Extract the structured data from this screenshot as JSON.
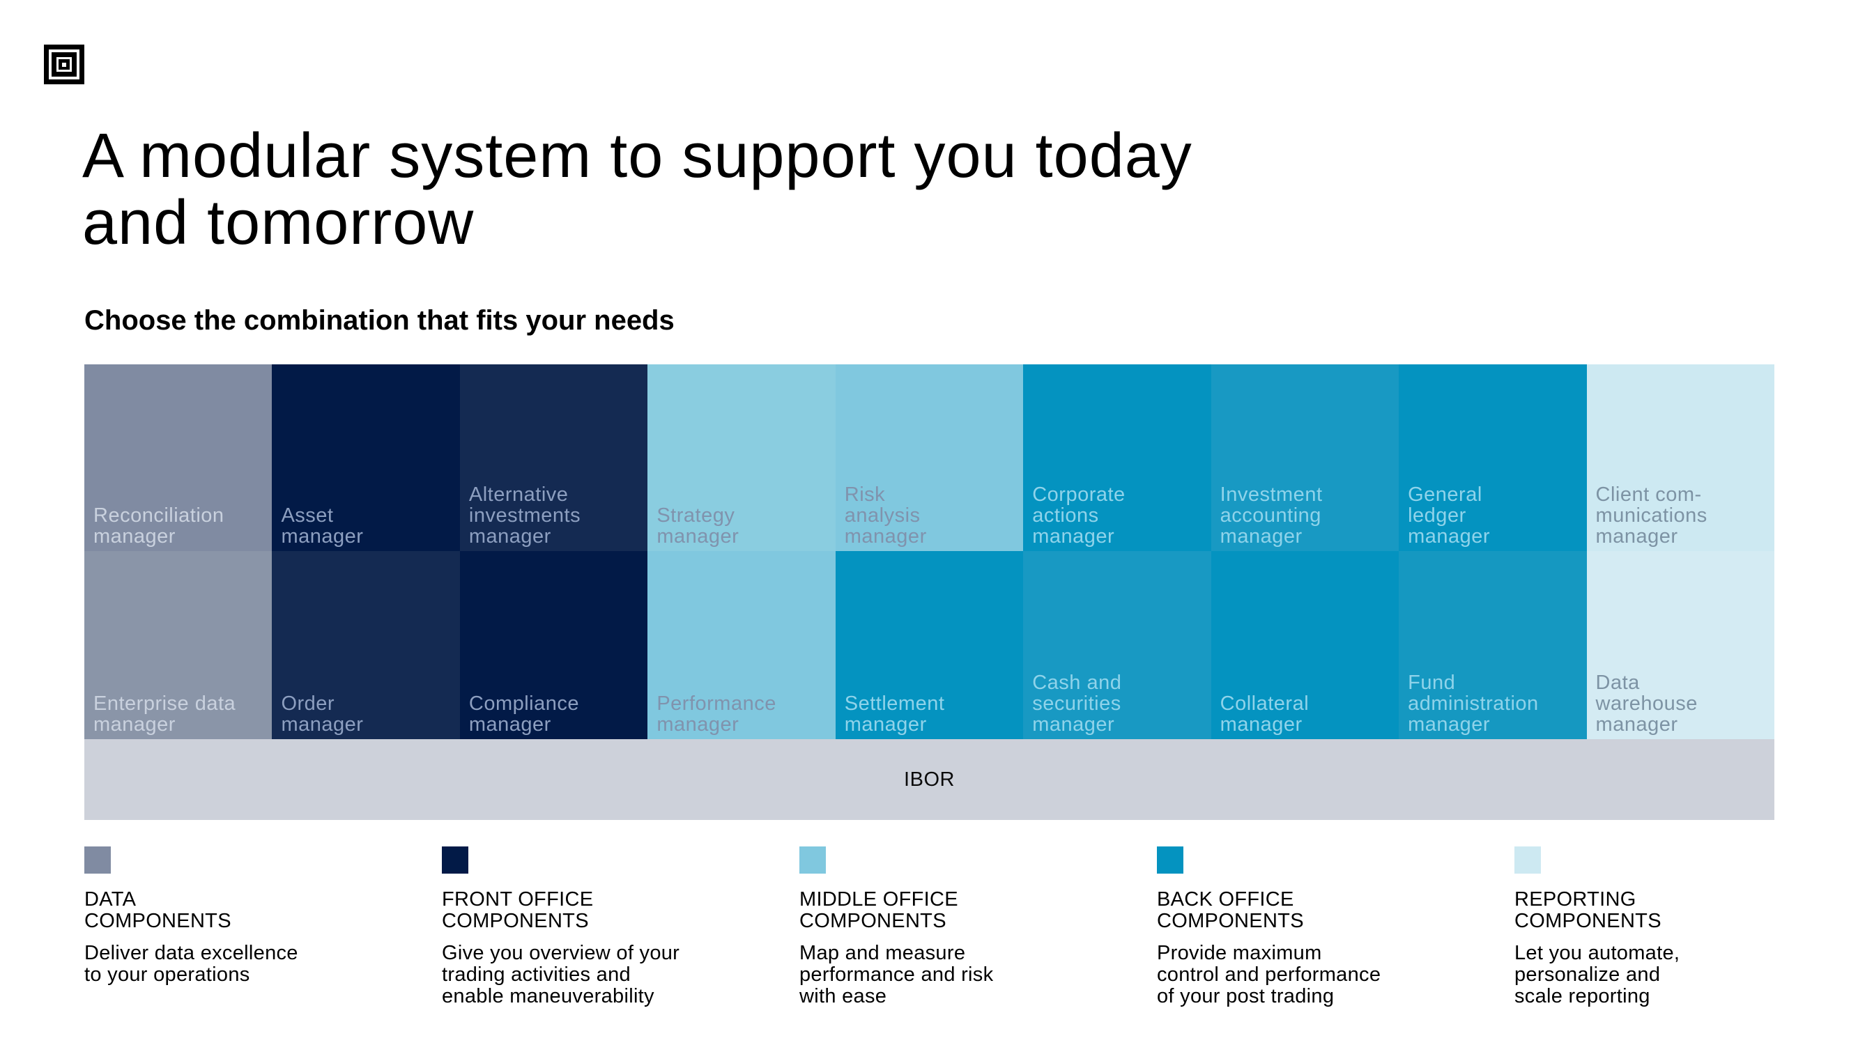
{
  "header": {
    "logo_icon": "concentric-squares-logo-icon",
    "title_lines": [
      "A modular system to support you today",
      "and tomorrow"
    ],
    "subtitle": "Choose the combination that fits your needs"
  },
  "categories": {
    "data": {
      "bg_top": "#808ba2",
      "bg_bottom": "#8a95a8",
      "text": "#c9d1de"
    },
    "front": {
      "bg_a": "#021a47",
      "bg_b": "#142a52",
      "text": "#8d9fc0"
    },
    "middle": {
      "bg_a": "#8acde0",
      "bg_b": "#80c8df",
      "text": "#8093ad"
    },
    "back": {
      "bg_a": "#0493c0",
      "bg_b": "#1899c3",
      "text": "#8fd3ea"
    },
    "reporting": {
      "bg_top": "#cde9f2",
      "bg_bottom": "#d4ebf3",
      "text": "#7d93a4"
    }
  },
  "grid": {
    "rows": [
      [
        {
          "lines": [
            "Reconciliation",
            "manager"
          ],
          "category": "data",
          "bg": "#808ba2"
        },
        {
          "lines": [
            "Asset",
            "manager"
          ],
          "category": "front",
          "bg": "#021a47"
        },
        {
          "lines": [
            "Alternative",
            "investments",
            "manager"
          ],
          "category": "front",
          "bg": "#142a52"
        },
        {
          "lines": [
            "Strategy",
            "manager"
          ],
          "category": "middle",
          "bg": "#8acde0"
        },
        {
          "lines": [
            "Risk",
            "analysis",
            "manager"
          ],
          "category": "middle",
          "bg": "#80c8df"
        },
        {
          "lines": [
            "Corporate",
            "actions",
            "manager"
          ],
          "category": "back",
          "bg": "#0493c0"
        },
        {
          "lines": [
            "Investment",
            "accounting",
            "manager"
          ],
          "category": "back",
          "bg": "#1899c3"
        },
        {
          "lines": [
            "General",
            "ledger",
            "manager"
          ],
          "category": "back",
          "bg": "#0493c0"
        },
        {
          "lines": [
            "Client com-",
            "munications",
            "manager"
          ],
          "category": "reporting",
          "bg": "#cde9f2"
        }
      ],
      [
        {
          "lines": [
            "Enterprise data",
            "manager"
          ],
          "category": "data",
          "bg": "#8a95a8"
        },
        {
          "lines": [
            "Order",
            "manager"
          ],
          "category": "front",
          "bg": "#142a52"
        },
        {
          "lines": [
            "Compliance",
            "manager"
          ],
          "category": "front",
          "bg": "#021a47"
        },
        {
          "lines": [
            "Performance",
            "manager"
          ],
          "category": "middle",
          "bg": "#80c8df"
        },
        {
          "lines": [
            "Settlement",
            "manager"
          ],
          "category": "back",
          "bg": "#0493c0"
        },
        {
          "lines": [
            "Cash and",
            "securities",
            "manager"
          ],
          "category": "back",
          "bg": "#1899c3"
        },
        {
          "lines": [
            "Collateral",
            "manager"
          ],
          "category": "back",
          "bg": "#0493c0"
        },
        {
          "lines": [
            "Fund",
            "administration",
            "manager"
          ],
          "category": "back",
          "bg": "#1598c1"
        },
        {
          "lines": [
            "Data",
            "warehouse",
            "manager"
          ],
          "category": "reporting",
          "bg": "#d4ebf3"
        }
      ]
    ],
    "base_layer": "IBOR"
  },
  "legend": [
    {
      "id": "data",
      "color": "#808ba2",
      "heading": [
        "DATA",
        "COMPONENTS"
      ],
      "description": [
        "Deliver data excellence",
        "to your operations"
      ]
    },
    {
      "id": "front-office",
      "color": "#021a47",
      "heading": [
        "FRONT OFFICE",
        "COMPONENTS"
      ],
      "description": [
        "Give you overview of your",
        "trading activities and",
        "enable maneuverability"
      ]
    },
    {
      "id": "middle-office",
      "color": "#80c8df",
      "heading": [
        "MIDDLE OFFICE",
        "COMPONENTS"
      ],
      "description": [
        "Map and measure",
        "performance and risk",
        "with ease"
      ]
    },
    {
      "id": "back-office",
      "color": "#0493c0",
      "heading": [
        "BACK OFFICE",
        "COMPONENTS"
      ],
      "description": [
        "Provide maximum",
        "control and performance",
        "of your post trading"
      ]
    },
    {
      "id": "reporting",
      "color": "#cde9f2",
      "heading": [
        "REPORTING",
        "COMPONENTS"
      ],
      "description": [
        "Let you automate,",
        "personalize and",
        "scale reporting"
      ]
    }
  ]
}
